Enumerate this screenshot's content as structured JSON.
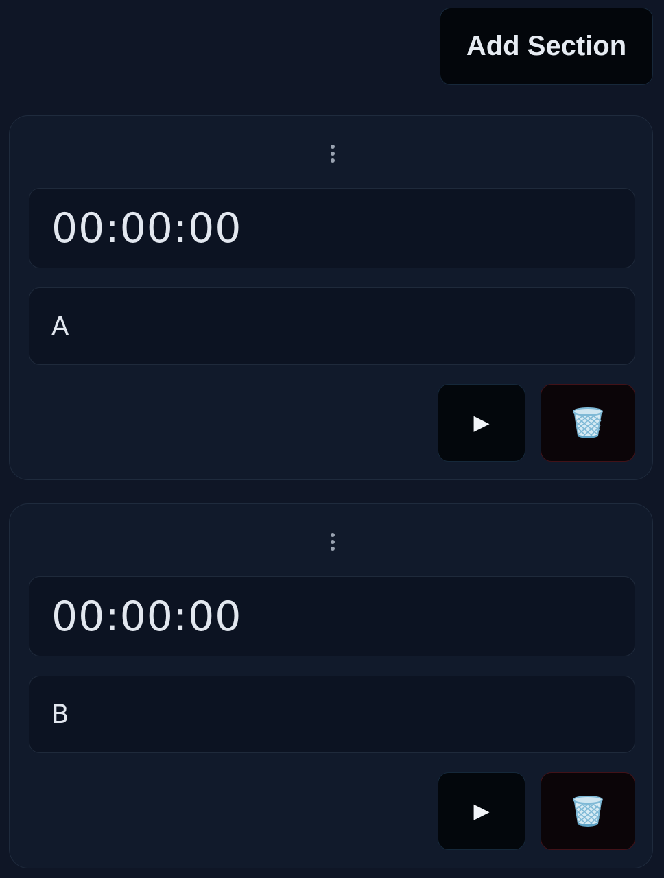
{
  "toolbar": {
    "add_section_label": "Add Section"
  },
  "sections": [
    {
      "time": "00:00:00",
      "label": "A",
      "drag_icon": "vertical-ellipsis-icon",
      "play_icon": "play-icon",
      "play_symbol": "▶",
      "delete_icon": "trash-icon"
    },
    {
      "time": "00:00:00",
      "label": "B",
      "drag_icon": "vertical-ellipsis-icon",
      "play_icon": "play-icon",
      "play_symbol": "▶",
      "delete_icon": "trash-icon"
    }
  ],
  "colors": {
    "background": "#0f1626",
    "card": "#111a2b",
    "field": "#0c1322",
    "delete_border": "#421218",
    "trash_blue": "#7fb9d6"
  }
}
